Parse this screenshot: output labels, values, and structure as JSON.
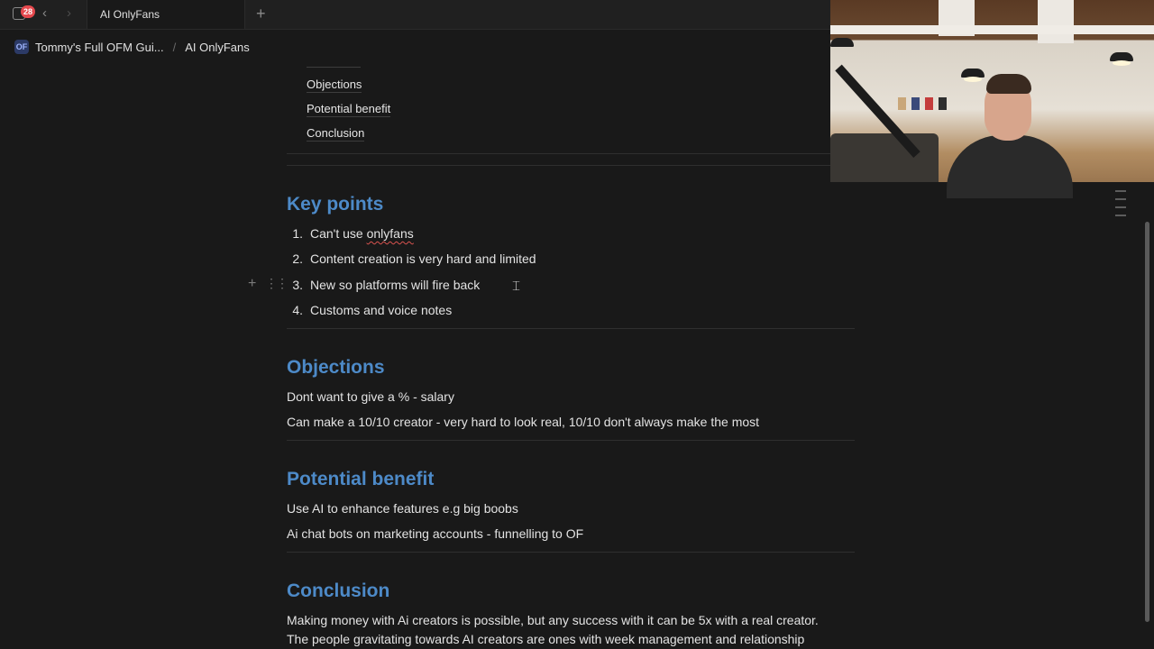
{
  "tabbar": {
    "badge_count": "28",
    "tab_title": "AI OnlyFans",
    "new_tab_symbol": "+"
  },
  "breadcrumb": {
    "workspace_icon": "OF",
    "parent": "Tommy's Full OFM Gui...",
    "separator": "/",
    "current": "AI OnlyFans"
  },
  "toc": {
    "items": [
      "Objections",
      "Potential benefit",
      "Conclusion"
    ]
  },
  "sections": {
    "key_points": {
      "heading": "Key points",
      "items": [
        {
          "num": "1.",
          "text_before": "Can't use ",
          "text_flag": "onlyfans",
          "text_after": ""
        },
        {
          "num": "2.",
          "text": "Content creation is very hard and limited"
        },
        {
          "num": "3.",
          "text": "New so platforms will fire back"
        },
        {
          "num": "4.",
          "text": "Customs and voice notes"
        }
      ]
    },
    "objections": {
      "heading": "Objections",
      "lines": [
        "Dont want to give a % - salary",
        "Can make a 10/10 creator - very hard to look real, 10/10 don't always make the most"
      ]
    },
    "potential_benefit": {
      "heading": "Potential benefit",
      "lines": [
        "Use AI to enhance features e.g big boobs",
        "Ai chat bots on marketing accounts - funnelling to OF"
      ]
    },
    "conclusion": {
      "heading": "Conclusion",
      "lines": [
        "Making money with Ai creators is possible, but any success with it can be 5x with a real creator.",
        "The people gravitating towards AI creators are ones with week management and relationship"
      ]
    }
  },
  "block_controls": {
    "add_symbol": "+",
    "drag_symbol": "⋮⋮"
  },
  "icons": {
    "sidebar": "sidebar-toggle-icon",
    "back": "chevron-left-icon",
    "forward": "chevron-right-icon",
    "new_tab": "plus-icon",
    "cursor": "text-cursor-icon",
    "outline": "outline-icon"
  },
  "colors": {
    "background": "#191919",
    "heading": "#4d8ac8",
    "badge": "#e5484d"
  }
}
